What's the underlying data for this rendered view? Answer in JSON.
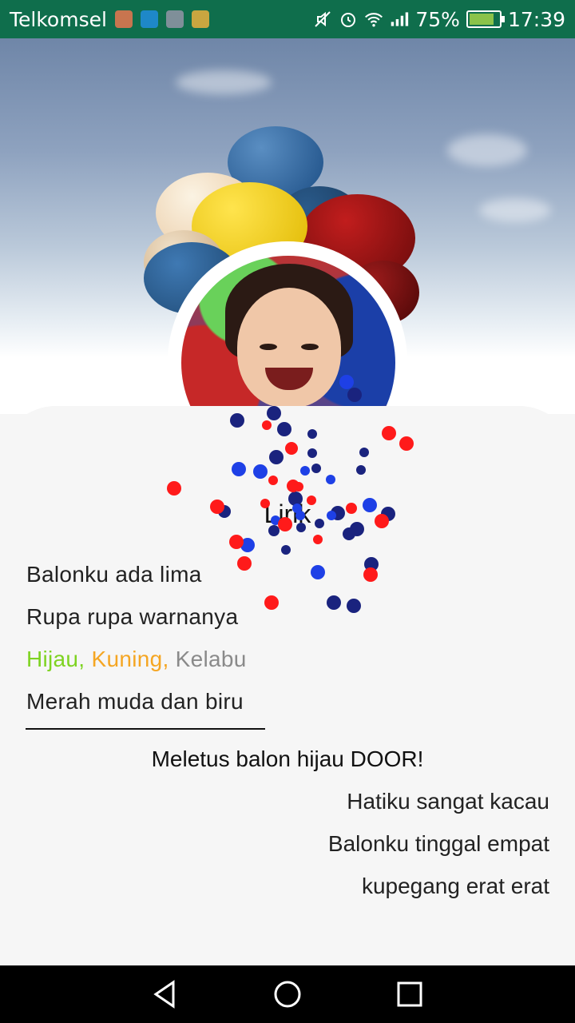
{
  "status_bar": {
    "carrier": "Telkomsel",
    "battery_percent": "75%",
    "time": "17:39"
  },
  "title": "Lirik",
  "lyrics": {
    "line1": "Balonku ada lima",
    "line2": "Rupa rupa warnanya",
    "line3_green": "Hijau,",
    "line3_yellow": "Kuning,",
    "line3_gray": "Kelabu",
    "line4": "Merah muda dan biru",
    "center_line": "Meletus balon hijau DOOR!",
    "right1": "Hatiku sangat kacau",
    "right2": "Balonku tinggal empat",
    "right3": "kupegang erat erat"
  },
  "colors": {
    "status_bar": "#0f6e4c",
    "green_text": "#7ed321",
    "yellow_text": "#f5a623",
    "gray_text": "#8a8a8a"
  }
}
